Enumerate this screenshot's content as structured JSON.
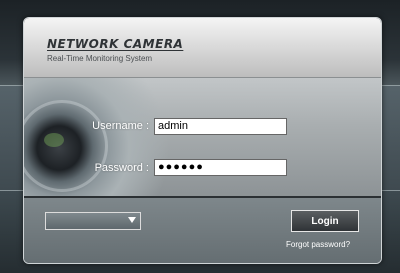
{
  "header": {
    "brand": "NETWORK CAMERA",
    "tagline": "Real-Time Monitoring System"
  },
  "form": {
    "username_label": "Username :",
    "username_value": "admin",
    "password_label": "Password :",
    "password_value": "●●●●●●"
  },
  "footer": {
    "language_selected": "",
    "login_label": "Login",
    "forgot_label": "Forgot password?"
  },
  "icons": {
    "select_arrow": "chevron-down-icon",
    "lens": "camera-lens-icon"
  },
  "colors": {
    "background": "#4a5358",
    "header": "#d6d6d6",
    "button": "#2f3336"
  }
}
